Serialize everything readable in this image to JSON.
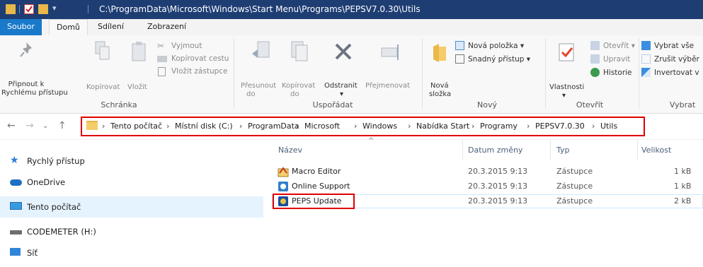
{
  "window": {
    "title_path": "C:\\ProgramData\\Microsoft\\Windows\\Start Menu\\Programs\\PEPSV7.0.30\\Utils"
  },
  "tabs": [
    "Soubor",
    "Domů",
    "Sdílení",
    "Zobrazení"
  ],
  "ribbon": {
    "schranka": {
      "label": "Schránka",
      "pin_line1": "Připnout k",
      "pin_line2": "Rychlému přístupu",
      "copy": "Kopírovat",
      "paste": "Vložit",
      "cut": "Vyjmout",
      "copy_path": "Kopírovat cestu",
      "paste_shortcut": "Vložit zástupce"
    },
    "usporadat": {
      "label": "Uspořádat",
      "move_line1": "Přesunout",
      "move_line2": "do",
      "copyto_line1": "Kopírovat",
      "copyto_line2": "do",
      "delete": "Odstranit",
      "rename": "Přejmenovat"
    },
    "novy": {
      "label": "Nový",
      "new_folder_line1": "Nová",
      "new_folder_line2": "složka",
      "new_item": "Nová položka ▾",
      "easy_access": "Snadný přístup ▾"
    },
    "otevrit": {
      "label": "Otevřít",
      "properties": "Vlastnosti",
      "open": "Otevřít ▾",
      "edit": "Upravit",
      "history": "Historie"
    },
    "vybrat": {
      "label": "Vybrat",
      "select_all": "Vybrat vše",
      "select_none": "Zrušit výběr",
      "invert": "Invertovat v"
    }
  },
  "breadcrumb": [
    "Tento počítač",
    "Místní disk (C:)",
    "ProgramData",
    "Microsoft",
    "Windows",
    "Nabídka Start",
    "Programy",
    "PEPSV7.0.30",
    "Utils"
  ],
  "nav": [
    {
      "label": "Rychlý přístup",
      "icon": "star-icon"
    },
    {
      "label": "OneDrive",
      "icon": "cloud-icon"
    },
    {
      "label": "Tento počítač",
      "icon": "computer-icon"
    },
    {
      "label": "CODEMETER (H:)",
      "icon": "drive-icon"
    },
    {
      "label": "Síť",
      "icon": "network-icon"
    }
  ],
  "columns": {
    "name": "Název",
    "date": "Datum změny",
    "type": "Typ",
    "size": "Velikost"
  },
  "files": [
    {
      "name": "Macro Editor",
      "date": "20.3.2015 9:13",
      "type": "Zástupce",
      "size": "1 kB"
    },
    {
      "name": "Online Support",
      "date": "20.3.2015 9:13",
      "type": "Zástupce",
      "size": "1 kB"
    },
    {
      "name": "PEPS Update",
      "date": "20.3.2015 9:13",
      "type": "Zástupce",
      "size": "2 kB"
    }
  ]
}
